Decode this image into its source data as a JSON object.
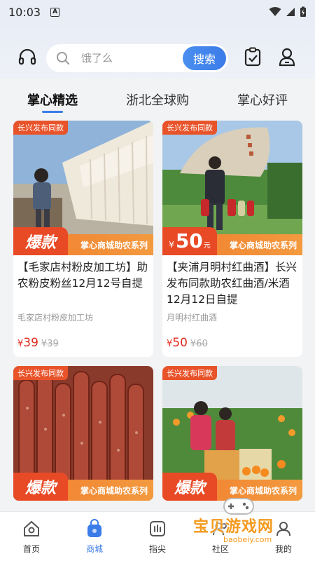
{
  "status": {
    "time": "10:03"
  },
  "search": {
    "placeholder": "饿了么",
    "button": "搜索"
  },
  "tabs": [
    "掌心精选",
    "浙北全球购",
    "掌心好评"
  ],
  "products": [
    {
      "tag": "长兴发布同款",
      "badge_text": "爆款",
      "badge_price": "",
      "banner": "掌心商城助农系列",
      "title": "【毛家店村粉皮加工坊】助农粉皮粉丝12月12号自提",
      "shop": "毛家店村粉皮加工坊",
      "currency": "¥",
      "price": "39",
      "old_price": "¥39"
    },
    {
      "tag": "长兴发布同款",
      "badge_text": "",
      "badge_price": "50",
      "badge_unit": "元",
      "banner": "掌心商城助农系列",
      "title": "【夹浦月明村红曲酒】长兴发布同款助农红曲酒/米酒12月12日自提",
      "shop": "月明村红曲酒",
      "currency": "¥",
      "price": "50",
      "old_price": "¥60"
    },
    {
      "tag": "长兴发布同款",
      "badge_text": "爆款",
      "banner": "掌心商城助农系列"
    },
    {
      "tag": "长兴发布同款",
      "badge_text": "爆款",
      "banner": "掌心商城助农系列"
    }
  ],
  "nav": [
    {
      "label": "首页",
      "icon": "home-icon"
    },
    {
      "label": "商城",
      "icon": "shopping-bag-icon"
    },
    {
      "label": "指尖",
      "icon": "fingertip-icon"
    },
    {
      "label": "社区",
      "icon": "community-icon"
    },
    {
      "label": "我的",
      "icon": "profile-icon"
    }
  ],
  "watermark": {
    "title": "宝贝游戏网",
    "url": "baobeiy.com"
  },
  "colors": {
    "accent": "#3b7ce8",
    "price": "#e02a1f",
    "badge": "#e84a25",
    "banner": "#f07d2e"
  }
}
